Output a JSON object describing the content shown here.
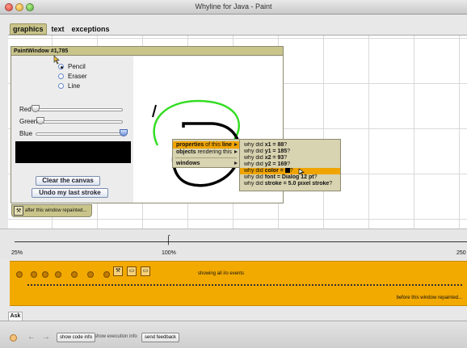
{
  "window": {
    "title": "Whyline for Java - Paint"
  },
  "tabs": [
    {
      "label": "graphics",
      "active": true
    },
    {
      "label": "text",
      "active": false
    },
    {
      "label": "exceptions",
      "active": false
    }
  ],
  "paint_window": {
    "title": "PaintWindow #1,785",
    "tools": [
      {
        "label": "Pencil",
        "selected": true
      },
      {
        "label": "Eraser",
        "selected": false
      },
      {
        "label": "Line",
        "selected": false
      }
    ],
    "sliders": [
      {
        "label": "Red",
        "value": 0
      },
      {
        "label": "Green",
        "value": 0
      },
      {
        "label": "Blue",
        "value": 1
      }
    ],
    "current_color": "#000000",
    "clear_button": "Clear the canvas",
    "undo_button": "Undo my last stroke",
    "repaint_label": "after this window repainted..."
  },
  "context_menu": {
    "items": [
      {
        "label_bold": "properties",
        "label_rest": " of this ",
        "label_bold2": "line",
        "highlighted": true
      },
      {
        "label_bold": "objects",
        "label_rest": " rendering this",
        "label_bold2": "",
        "highlighted": false
      },
      {
        "label_bold": "windows",
        "label_rest": "",
        "label_bold2": "",
        "highlighted": false
      }
    ],
    "submenu": [
      {
        "pre": "why did ",
        "bold": "x1 = 88",
        "post": "?",
        "highlighted": false
      },
      {
        "pre": "why did ",
        "bold": "y1 = 185",
        "post": "?",
        "highlighted": false
      },
      {
        "pre": "why did ",
        "bold": "x2 = 93",
        "post": "?",
        "highlighted": false
      },
      {
        "pre": "why did ",
        "bold": "y2 = 169",
        "post": "?",
        "highlighted": false
      },
      {
        "pre": "why did ",
        "bold": "color = ",
        "post": "?",
        "highlighted": true,
        "swatch": "#000000"
      },
      {
        "pre": "why did ",
        "bold": "font = Dialog 12 pt",
        "post": "?",
        "highlighted": false
      },
      {
        "pre": "why did ",
        "bold": "stroke = 5.0 pixel stroke",
        "post": "?",
        "highlighted": false
      }
    ]
  },
  "timeline": {
    "left_label": "25%",
    "mid_label": "100%",
    "right_label": "250"
  },
  "events": {
    "showing_label": "showing all i/o events",
    "before_label": "before this window repainted..."
  },
  "ask": {
    "tab_label": "Ask",
    "show_code_info": "show code info",
    "show_execution_info": "show execution info",
    "send_feedback": "send feedback"
  }
}
